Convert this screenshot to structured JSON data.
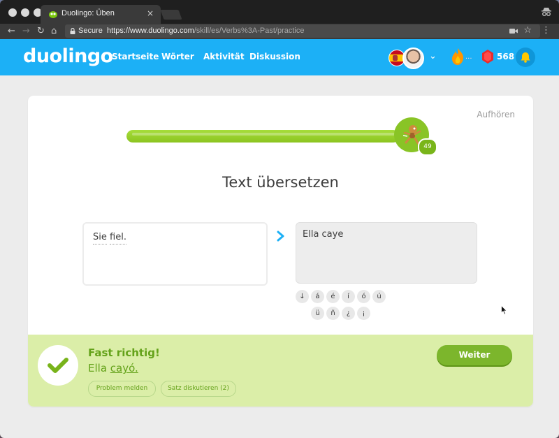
{
  "browser": {
    "tab_title": "Duolingo: Üben",
    "tab_close": "×",
    "secure_label": "Secure",
    "url_host": "https://www.duolingo.com",
    "url_path": "/skill/es/Verbs%3A-Past/practice",
    "nav": {
      "back": "←",
      "forward": "→",
      "reload": "↻",
      "home": "⌂"
    },
    "star": "☆",
    "menu": "⋮"
  },
  "header": {
    "logo": "duolingo",
    "nav_items": [
      "Startseite",
      "Wörter",
      "Aktivität",
      "Diskussion"
    ],
    "streak": "...",
    "lingots": "568",
    "chevron": "⌄",
    "brand_color": "#1cb0f6"
  },
  "lesson": {
    "quit_label": "Aufhören",
    "progress_percent": 92,
    "progress_badge": "49",
    "title": "Text übersetzen",
    "source_words": [
      "Sie",
      "fiel."
    ],
    "answer": "Ella caye",
    "special_chars_row1": [
      "↓",
      "á",
      "é",
      "í",
      "ó",
      "ú"
    ],
    "special_chars_row2": [
      "ü",
      "ñ",
      "¿",
      "¡"
    ]
  },
  "feedback": {
    "title": "Fast richtig!",
    "solution_prefix": "Ella ",
    "solution_highlight": "cayó.",
    "report_label": "Problem melden",
    "discuss_label": "Satz diskutieren (2)",
    "continue_label": "Weiter",
    "status_color": "#64a21a"
  }
}
